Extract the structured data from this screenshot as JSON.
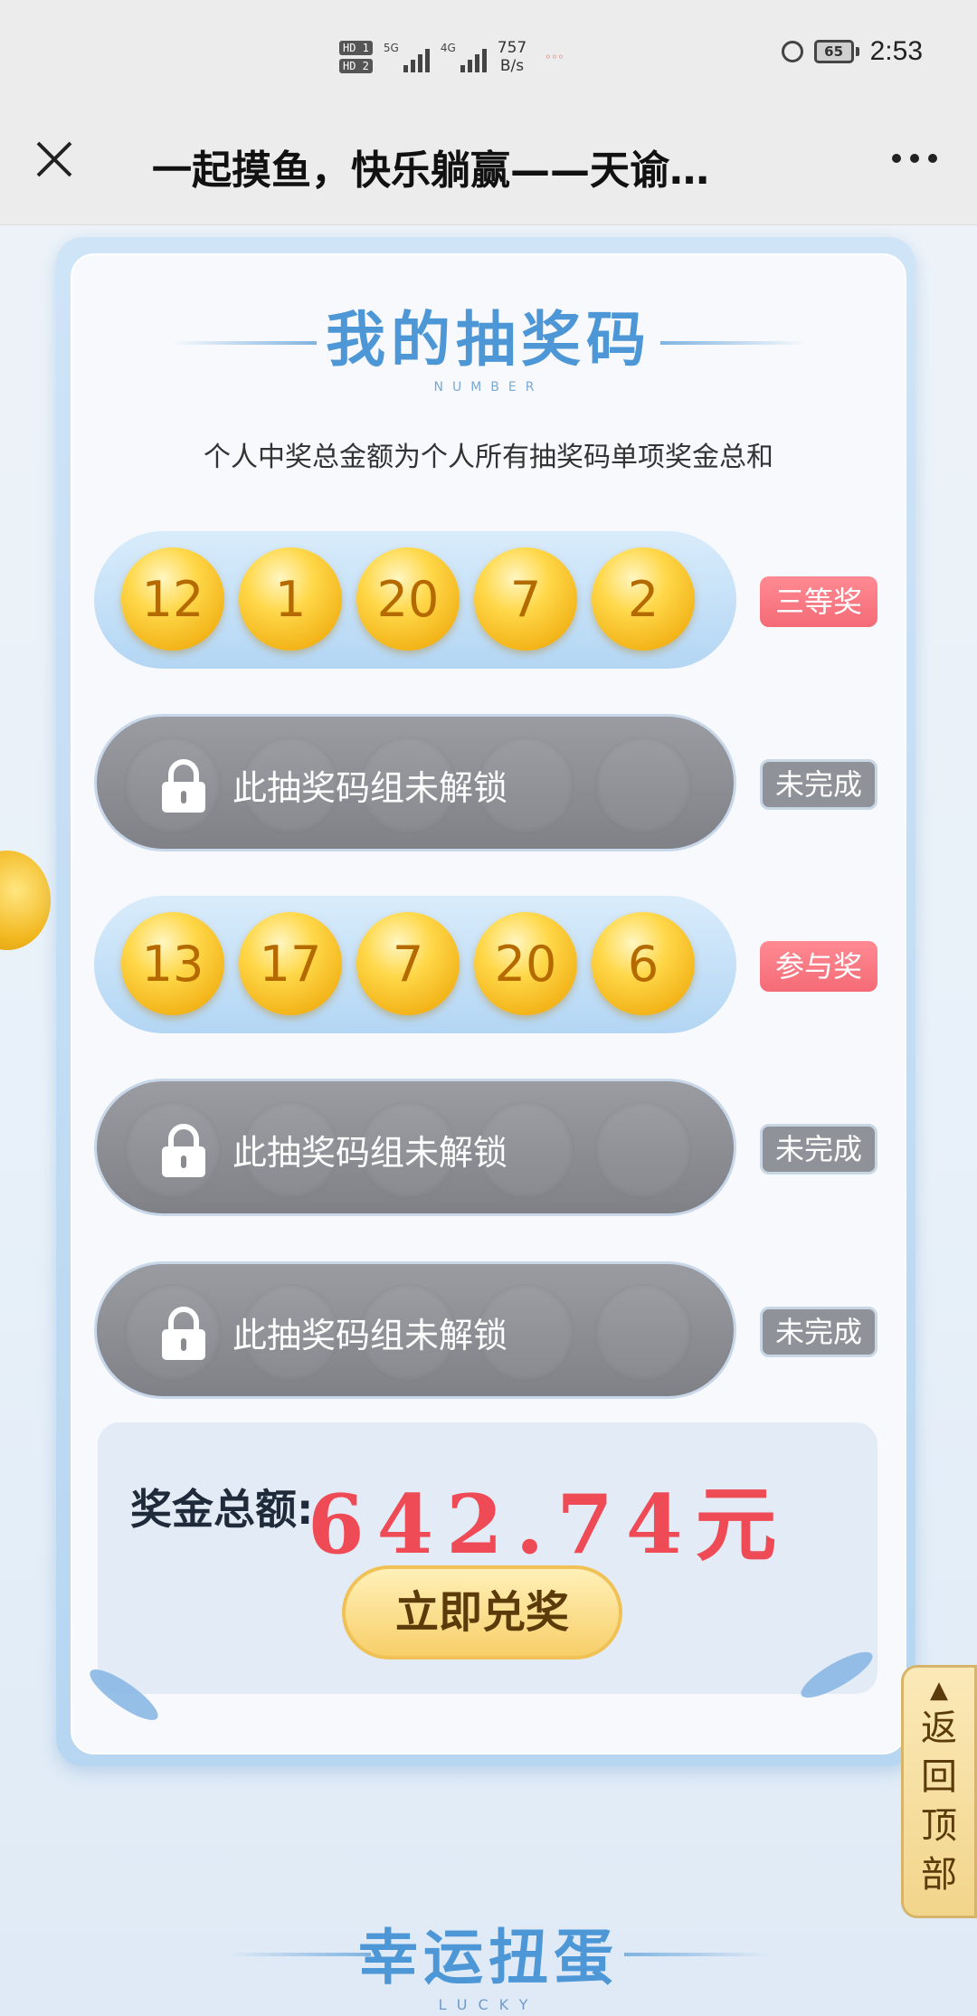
{
  "status_bar": {
    "sim1": "HD 1",
    "sim2": "HD 2",
    "net1": "5G",
    "net2": "4G",
    "speed_value": "757",
    "speed_unit": "B/s",
    "battery": "65",
    "time": "2:53"
  },
  "nav": {
    "title": "一起摸鱼，快乐躺赢——天谕…"
  },
  "lottery": {
    "title": "我的抽奖码",
    "subtitle": "NUMBER",
    "note": "个人中奖总金额为个人所有抽奖码单项奖金总和",
    "rows": [
      {
        "numbers": [
          "12",
          "1",
          "20",
          "7",
          "2"
        ],
        "status": "三等奖"
      },
      {
        "locked_text": "此抽奖码组未解锁",
        "status": "未完成"
      },
      {
        "numbers": [
          "13",
          "17",
          "7",
          "20",
          "6"
        ],
        "status": "参与奖"
      },
      {
        "locked_text": "此抽奖码组未解锁",
        "status": "未完成"
      },
      {
        "locked_text": "此抽奖码组未解锁",
        "status": "未完成"
      }
    ],
    "total_label": "奖金总额:",
    "total_amount": "642.74元",
    "redeem_button": "立即兑奖"
  },
  "back_to_top": {
    "arrow": "▲",
    "label": [
      "返",
      "回",
      "顶",
      "部"
    ]
  },
  "next_section": {
    "title": "幸运扭蛋",
    "subtitle": "LUCKY"
  },
  "colors": {
    "accent_blue": "#4e97d6",
    "prize_red": "#ef4b56",
    "gold": "#f3b51a"
  }
}
